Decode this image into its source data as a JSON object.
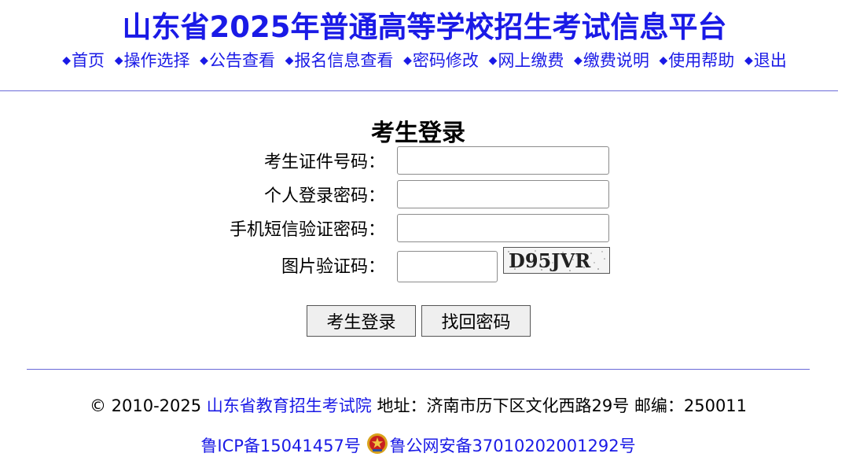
{
  "header": {
    "title": "山东省2025年普通高等学校招生考试信息平台"
  },
  "nav": {
    "bullet": "◆",
    "items": [
      "首页",
      "操作选择",
      "公告查看",
      "报名信息查看",
      "密码修改",
      "网上缴费",
      "缴费说明",
      "使用帮助",
      "退出"
    ]
  },
  "login": {
    "title": "考生登录",
    "fields": {
      "id_label": "考生证件号码：",
      "id_value": "",
      "password_label": "个人登录密码：",
      "password_value": "",
      "sms_label": "手机短信验证密码：",
      "sms_value": "",
      "captcha_label": "图片验证码：",
      "captcha_value": ""
    },
    "captcha_text": "D95JVR",
    "buttons": {
      "login": "考生登录",
      "recover": "找回密码"
    }
  },
  "footer": {
    "copyright": "© 2010-2025",
    "org_link": "山东省教育招生考试院",
    "address": "地址：济南市历下区文化西路29号 邮编：250011",
    "icp": "鲁ICP备15041457号",
    "police": "鲁公网安备37010202001292号"
  },
  "colors": {
    "link": "#1a1ae6",
    "rule": "#6a6ad8",
    "button_bg": "#efefef"
  },
  "icons": {
    "nav_bullet": "diamond-bullet-icon",
    "police": "police-emblem-icon"
  }
}
